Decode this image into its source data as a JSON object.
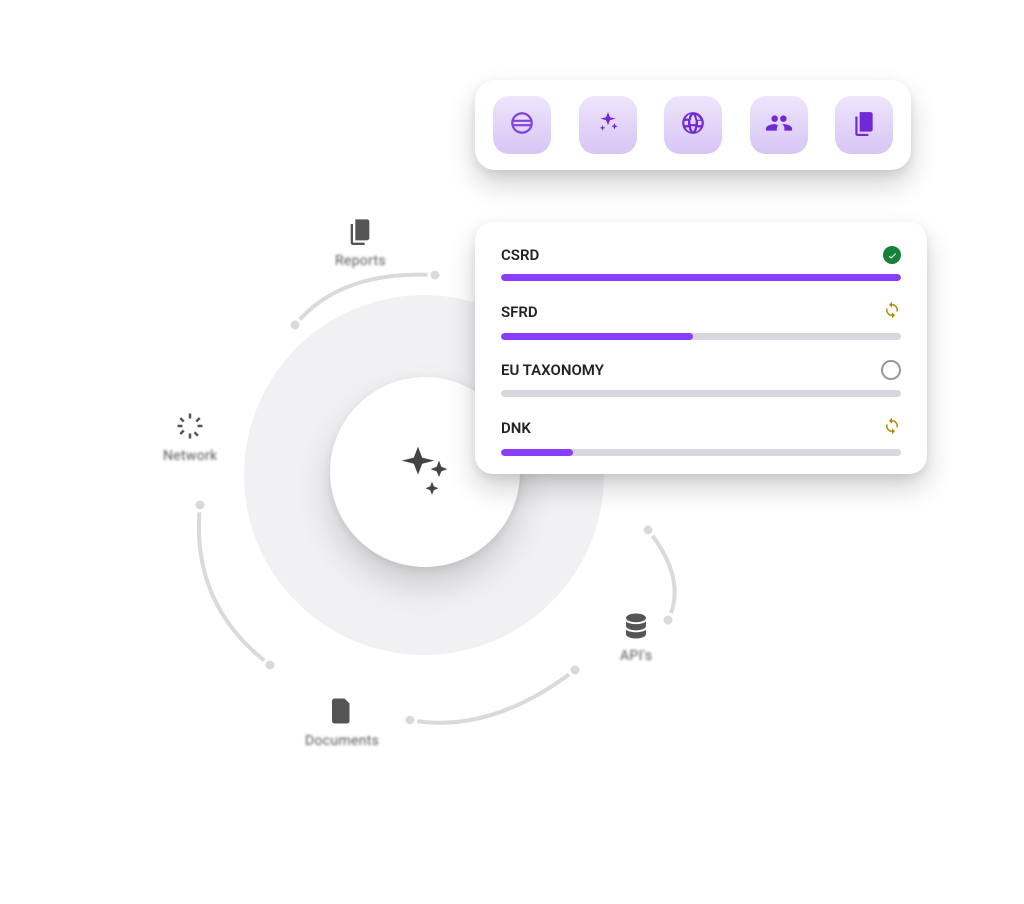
{
  "radial": {
    "items": [
      {
        "key": "reports",
        "label": "Reports"
      },
      {
        "key": "network",
        "label": "Network"
      },
      {
        "key": "documents",
        "label": "Documents"
      },
      {
        "key": "apis",
        "label": "API's"
      }
    ],
    "center_icon": "sparkle-icon"
  },
  "toolbar": {
    "icons": [
      "dashed-globe-icon",
      "sparkle-icon",
      "globe-icon",
      "team-icon",
      "documents-icon"
    ]
  },
  "progress": {
    "rows": [
      {
        "name": "CSRD",
        "percent": 100,
        "status": "done"
      },
      {
        "name": "SFRD",
        "percent": 48,
        "status": "sync"
      },
      {
        "name": "EU TAXONOMY",
        "percent": 0,
        "status": "empty"
      },
      {
        "name": "DNK",
        "percent": 18,
        "status": "sync"
      }
    ]
  },
  "colors": {
    "accent_purple": "#8b3dff",
    "toolbar_tile": "#d7c5f5",
    "status_done": "#188038",
    "status_sync": "#b68900"
  }
}
